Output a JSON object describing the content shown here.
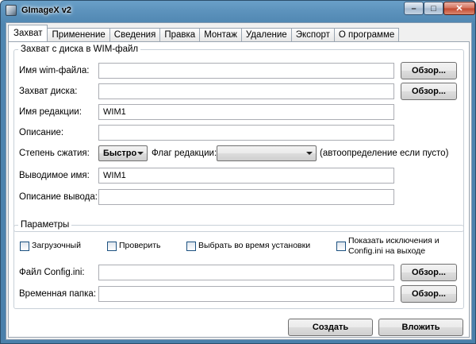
{
  "window": {
    "title": "GImageX v2"
  },
  "tabs": [
    "Захват",
    "Применение",
    "Сведения",
    "Правка",
    "Монтаж",
    "Удаление",
    "Экспорт",
    "О программе"
  ],
  "capture_group": {
    "legend": "Захват с диска в WIM-файл",
    "wim_file_label": "Имя wim-файла:",
    "wim_file_value": "",
    "disk_label": "Захват диска:",
    "disk_value": "",
    "edition_name_label": "Имя редакции:",
    "edition_name_value": "WIM1",
    "description_label": "Описание:",
    "description_value": "",
    "compression_label": "Степень сжатия:",
    "compression_value": "Быстро",
    "edition_flag_label": "Флаг редакции:",
    "edition_flag_value": "",
    "edition_flag_hint": "(автоопределение если пусто)",
    "output_name_label": "Выводимое имя:",
    "output_name_value": "WIM1",
    "output_description_label": "Описание вывода:",
    "output_description_value": "",
    "browse_label": "Обзор..."
  },
  "params_group": {
    "legend": "Параметры",
    "bootable_label": "Загрузочный",
    "verify_label": "Проверить",
    "choose_install_label": "Выбрать во время установки",
    "show_exclusions_line1": "Показать исключения и",
    "show_exclusions_line2": "Config.ini на выходе",
    "config_label": "Файл Config.ini:",
    "config_value": "",
    "temp_label": "Временная папка:",
    "temp_value": "",
    "browse_label": "Обзор..."
  },
  "actions": {
    "create_label": "Создать",
    "append_label": "Вложить"
  },
  "controls": {
    "min": "–",
    "max": "□",
    "close": "✕"
  }
}
